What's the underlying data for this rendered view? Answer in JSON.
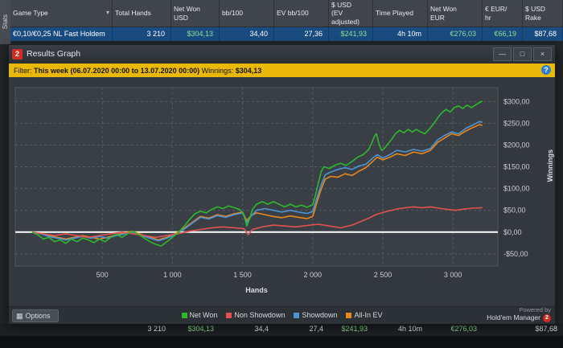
{
  "stats_tab": {
    "label": "Stats"
  },
  "table": {
    "columns": [
      {
        "key": "game-type",
        "header": "Game Type",
        "value": "€0,10/€0,25 NL Fast Holdem",
        "total": "",
        "width": 127,
        "align": "left",
        "arrow": true
      },
      {
        "key": "total-hands",
        "header": "Total Hands",
        "value": "3 210",
        "total": "3 210",
        "width": 73
      },
      {
        "key": "net-won-usd",
        "header": "Net Won\nUSD",
        "value": "$304,13",
        "total": "$304,13",
        "width": 60,
        "pos": true
      },
      {
        "key": "bb-100",
        "header": "bb/100",
        "value": "34,40",
        "total": "34,4",
        "width": 68
      },
      {
        "key": "ev-bb-100",
        "header": "EV bb/100",
        "value": "27,36",
        "total": "27,4",
        "width": 68
      },
      {
        "key": "usd-ev-adjusted",
        "header": "$ USD\n(EV\nadjusted)",
        "value": "$241,93",
        "total": "$241,93",
        "width": 55,
        "pos": true
      },
      {
        "key": "time-played",
        "header": "Time Played",
        "value": "4h 10m",
        "total": "4h 10m",
        "width": 68
      },
      {
        "key": "net-won-eur",
        "header": "Net Won\nEUR",
        "value": "€276,03",
        "total": "€276,03",
        "width": 68,
        "pos": true
      },
      {
        "key": "eur-hr",
        "header": "€ EUR/\nhr",
        "value": "€66,19",
        "total": "",
        "width": 50,
        "pos": true
      },
      {
        "key": "usd-rake",
        "header": "$ USD\nRake",
        "value": "$87,68",
        "total": "$87,68",
        "width": 50
      }
    ]
  },
  "window": {
    "title": "Results Graph",
    "logo_glyph": "2",
    "controls": {
      "minimize": "—",
      "maximize": "□",
      "close": "×"
    }
  },
  "filter": {
    "label": "Filter: ",
    "range": "This week (06.07.2020 00:00 to 13.07.2020 00:00)",
    "winnings_label": " Winnings: ",
    "winnings_value": "$304,13",
    "help_glyph": "?"
  },
  "options_label": "Options",
  "options_icon_glyph": "▦",
  "powered": {
    "line1": "Powered by",
    "line2": "Hold'em Manager",
    "logo": "2"
  },
  "chart_data": {
    "type": "line",
    "title": "Results Graph",
    "xlabel": "Hands",
    "ylabel": "Winnings",
    "xlim": [
      -120,
      3320
    ],
    "ylim": [
      -78,
      332
    ],
    "grid": true,
    "legend_position": "bottom",
    "zero_line": true,
    "x_ticks": [
      {
        "v": 500,
        "label": "500"
      },
      {
        "v": 1000,
        "label": "1 000"
      },
      {
        "v": 1500,
        "label": "1 500"
      },
      {
        "v": 2000,
        "label": "2 000"
      },
      {
        "v": 2500,
        "label": "2 500"
      },
      {
        "v": 3000,
        "label": "3 000"
      }
    ],
    "y_ticks": [
      {
        "v": 300,
        "label": "$300,00"
      },
      {
        "v": 250,
        "label": "$250,00"
      },
      {
        "v": 200,
        "label": "$200,00"
      },
      {
        "v": 150,
        "label": "$150,00"
      },
      {
        "v": 100,
        "label": "$100,00"
      },
      {
        "v": 50,
        "label": "$50,00"
      },
      {
        "v": 0,
        "label": "$0,00"
      },
      {
        "v": -50,
        "label": "-$50,00"
      }
    ],
    "series": [
      {
        "name": "Net Won",
        "color": "#2eb82e",
        "points": [
          [
            0,
            0
          ],
          [
            40,
            -6
          ],
          [
            80,
            -16
          ],
          [
            120,
            -12
          ],
          [
            160,
            -22
          ],
          [
            200,
            -18
          ],
          [
            240,
            -26
          ],
          [
            280,
            -16
          ],
          [
            320,
            -22
          ],
          [
            360,
            -14
          ],
          [
            400,
            -18
          ],
          [
            440,
            -24
          ],
          [
            480,
            -16
          ],
          [
            520,
            -22
          ],
          [
            560,
            -12
          ],
          [
            600,
            -5
          ],
          [
            640,
            -12
          ],
          [
            680,
            -4
          ],
          [
            720,
            2
          ],
          [
            760,
            -6
          ],
          [
            800,
            -14
          ],
          [
            840,
            -22
          ],
          [
            880,
            -28
          ],
          [
            920,
            -32
          ],
          [
            960,
            -22
          ],
          [
            1000,
            -12
          ],
          [
            1040,
            -2
          ],
          [
            1080,
            12
          ],
          [
            1120,
            28
          ],
          [
            1160,
            42
          ],
          [
            1200,
            48
          ],
          [
            1240,
            44
          ],
          [
            1280,
            52
          ],
          [
            1320,
            58
          ],
          [
            1360,
            54
          ],
          [
            1400,
            60
          ],
          [
            1440,
            56
          ],
          [
            1480,
            52
          ],
          [
            1510,
            40
          ],
          [
            1530,
            14
          ],
          [
            1550,
            30
          ],
          [
            1570,
            52
          ],
          [
            1600,
            64
          ],
          [
            1640,
            70
          ],
          [
            1680,
            64
          ],
          [
            1720,
            70
          ],
          [
            1760,
            64
          ],
          [
            1800,
            58
          ],
          [
            1840,
            64
          ],
          [
            1880,
            58
          ],
          [
            1920,
            62
          ],
          [
            1960,
            57
          ],
          [
            2000,
            63
          ],
          [
            2020,
            85
          ],
          [
            2040,
            112
          ],
          [
            2060,
            138
          ],
          [
            2080,
            150
          ],
          [
            2120,
            146
          ],
          [
            2160,
            154
          ],
          [
            2200,
            158
          ],
          [
            2240,
            153
          ],
          [
            2280,
            162
          ],
          [
            2320,
            172
          ],
          [
            2360,
            178
          ],
          [
            2400,
            190
          ],
          [
            2420,
            204
          ],
          [
            2440,
            220
          ],
          [
            2455,
            226
          ],
          [
            2470,
            206
          ],
          [
            2490,
            188
          ],
          [
            2510,
            192
          ],
          [
            2530,
            200
          ],
          [
            2560,
            212
          ],
          [
            2590,
            226
          ],
          [
            2620,
            234
          ],
          [
            2650,
            228
          ],
          [
            2680,
            236
          ],
          [
            2710,
            230
          ],
          [
            2740,
            236
          ],
          [
            2770,
            230
          ],
          [
            2800,
            226
          ],
          [
            2830,
            236
          ],
          [
            2860,
            248
          ],
          [
            2890,
            262
          ],
          [
            2920,
            274
          ],
          [
            2950,
            282
          ],
          [
            2980,
            276
          ],
          [
            3010,
            286
          ],
          [
            3040,
            290
          ],
          [
            3070,
            284
          ],
          [
            3100,
            292
          ],
          [
            3130,
            286
          ],
          [
            3160,
            292
          ],
          [
            3190,
            298
          ],
          [
            3210,
            301
          ]
        ]
      },
      {
        "name": "Non Showdown",
        "color": "#e05252",
        "points": [
          [
            0,
            0
          ],
          [
            80,
            -4
          ],
          [
            160,
            -8
          ],
          [
            240,
            -4
          ],
          [
            320,
            -8
          ],
          [
            400,
            -12
          ],
          [
            480,
            -8
          ],
          [
            560,
            -4
          ],
          [
            640,
            0
          ],
          [
            720,
            -4
          ],
          [
            800,
            -8
          ],
          [
            880,
            -12
          ],
          [
            960,
            -8
          ],
          [
            1040,
            -4
          ],
          [
            1120,
            2
          ],
          [
            1200,
            6
          ],
          [
            1280,
            10
          ],
          [
            1360,
            12
          ],
          [
            1440,
            10
          ],
          [
            1510,
            8
          ],
          [
            1540,
            -6
          ],
          [
            1570,
            6
          ],
          [
            1640,
            12
          ],
          [
            1720,
            16
          ],
          [
            1800,
            14
          ],
          [
            1880,
            12
          ],
          [
            1960,
            15
          ],
          [
            2040,
            18
          ],
          [
            2120,
            14
          ],
          [
            2200,
            10
          ],
          [
            2280,
            16
          ],
          [
            2340,
            24
          ],
          [
            2400,
            32
          ],
          [
            2450,
            40
          ],
          [
            2500,
            45
          ],
          [
            2550,
            49
          ],
          [
            2600,
            53
          ],
          [
            2660,
            56
          ],
          [
            2720,
            58
          ],
          [
            2780,
            56
          ],
          [
            2840,
            58
          ],
          [
            2900,
            55
          ],
          [
            2960,
            52
          ],
          [
            3020,
            50
          ],
          [
            3080,
            53
          ],
          [
            3140,
            55
          ],
          [
            3210,
            56
          ]
        ]
      },
      {
        "name": "Showdown",
        "color": "#4d94d6",
        "points": [
          [
            0,
            0
          ],
          [
            60,
            -4
          ],
          [
            120,
            -10
          ],
          [
            180,
            -14
          ],
          [
            240,
            -18
          ],
          [
            300,
            -14
          ],
          [
            360,
            -10
          ],
          [
            420,
            -14
          ],
          [
            480,
            -10
          ],
          [
            540,
            -14
          ],
          [
            600,
            -8
          ],
          [
            660,
            -4
          ],
          [
            720,
            0
          ],
          [
            780,
            -8
          ],
          [
            840,
            -14
          ],
          [
            900,
            -20
          ],
          [
            960,
            -14
          ],
          [
            1020,
            -6
          ],
          [
            1080,
            6
          ],
          [
            1140,
            20
          ],
          [
            1200,
            34
          ],
          [
            1260,
            30
          ],
          [
            1320,
            38
          ],
          [
            1380,
            34
          ],
          [
            1440,
            40
          ],
          [
            1500,
            44
          ],
          [
            1530,
            22
          ],
          [
            1560,
            36
          ],
          [
            1600,
            50
          ],
          [
            1660,
            54
          ],
          [
            1720,
            50
          ],
          [
            1780,
            46
          ],
          [
            1840,
            50
          ],
          [
            1900,
            46
          ],
          [
            1960,
            43
          ],
          [
            2000,
            47
          ],
          [
            2030,
            78
          ],
          [
            2060,
            108
          ],
          [
            2090,
            132
          ],
          [
            2130,
            138
          ],
          [
            2180,
            144
          ],
          [
            2230,
            148
          ],
          [
            2280,
            144
          ],
          [
            2330,
            152
          ],
          [
            2380,
            156
          ],
          [
            2420,
            168
          ],
          [
            2460,
            178
          ],
          [
            2500,
            170
          ],
          [
            2550,
            178
          ],
          [
            2600,
            188
          ],
          [
            2660,
            184
          ],
          [
            2720,
            190
          ],
          [
            2780,
            186
          ],
          [
            2840,
            192
          ],
          [
            2890,
            212
          ],
          [
            2940,
            222
          ],
          [
            2990,
            230
          ],
          [
            3040,
            226
          ],
          [
            3090,
            238
          ],
          [
            3140,
            246
          ],
          [
            3190,
            254
          ],
          [
            3210,
            252
          ]
        ]
      },
      {
        "name": "All-In EV",
        "color": "#e8881a",
        "points": [
          [
            0,
            0
          ],
          [
            60,
            -3
          ],
          [
            120,
            -8
          ],
          [
            180,
            -12
          ],
          [
            240,
            -16
          ],
          [
            300,
            -12
          ],
          [
            360,
            -8
          ],
          [
            420,
            -12
          ],
          [
            480,
            -16
          ],
          [
            540,
            -12
          ],
          [
            600,
            -6
          ],
          [
            660,
            -2
          ],
          [
            720,
            2
          ],
          [
            780,
            -6
          ],
          [
            840,
            -12
          ],
          [
            900,
            -18
          ],
          [
            960,
            -12
          ],
          [
            1020,
            -4
          ],
          [
            1080,
            8
          ],
          [
            1140,
            22
          ],
          [
            1200,
            36
          ],
          [
            1260,
            32
          ],
          [
            1320,
            40
          ],
          [
            1380,
            36
          ],
          [
            1440,
            42
          ],
          [
            1500,
            46
          ],
          [
            1530,
            26
          ],
          [
            1560,
            38
          ],
          [
            1600,
            44
          ],
          [
            1660,
            40
          ],
          [
            1720,
            36
          ],
          [
            1780,
            33
          ],
          [
            1840,
            37
          ],
          [
            1900,
            34
          ],
          [
            1960,
            31
          ],
          [
            2000,
            36
          ],
          [
            2030,
            68
          ],
          [
            2060,
            98
          ],
          [
            2090,
            122
          ],
          [
            2130,
            128
          ],
          [
            2180,
            126
          ],
          [
            2230,
            134
          ],
          [
            2280,
            130
          ],
          [
            2330,
            140
          ],
          [
            2380,
            148
          ],
          [
            2420,
            160
          ],
          [
            2460,
            172
          ],
          [
            2500,
            166
          ],
          [
            2550,
            172
          ],
          [
            2600,
            180
          ],
          [
            2660,
            176
          ],
          [
            2720,
            184
          ],
          [
            2780,
            180
          ],
          [
            2840,
            188
          ],
          [
            2890,
            206
          ],
          [
            2940,
            216
          ],
          [
            2990,
            226
          ],
          [
            3040,
            222
          ],
          [
            3090,
            232
          ],
          [
            3140,
            240
          ],
          [
            3190,
            247
          ],
          [
            3210,
            245
          ]
        ]
      }
    ]
  }
}
